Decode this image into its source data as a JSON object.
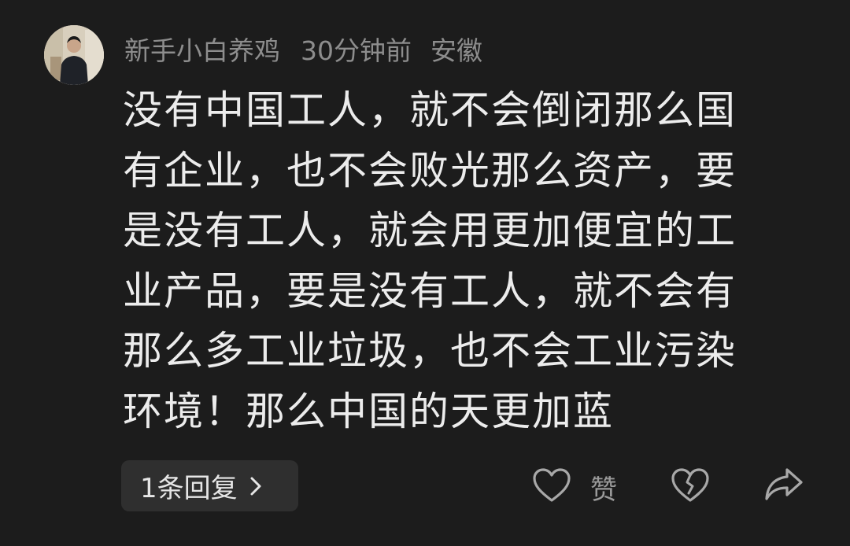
{
  "comment": {
    "username": "新手小白养鸡",
    "time": "30分钟前",
    "location": "安徽",
    "lines": [
      "没有中国工人，就不会倒闭那么国",
      "有企业，也不会败光那么资产，要",
      "是没有工人，就会用更加便宜的工",
      "业产品，要是没有工人，就不会有",
      "那么多工业垃圾，也不会工业污染",
      "环境！那么中国的天更加蓝"
    ]
  },
  "actions": {
    "reply_label": "1条回复",
    "like_label": "赞",
    "icons": {
      "avatar": "user-avatar",
      "reply_chevron": "chevron-right-icon",
      "like": "heart-icon",
      "dislike": "broken-heart-icon",
      "share": "share-arrow-icon"
    }
  },
  "colors": {
    "background": "#1c1c1c",
    "text": "#ececec",
    "meta_text": "#8d8d8d",
    "button_bg": "#2f2f2f",
    "icon": "#a8a8a8"
  }
}
